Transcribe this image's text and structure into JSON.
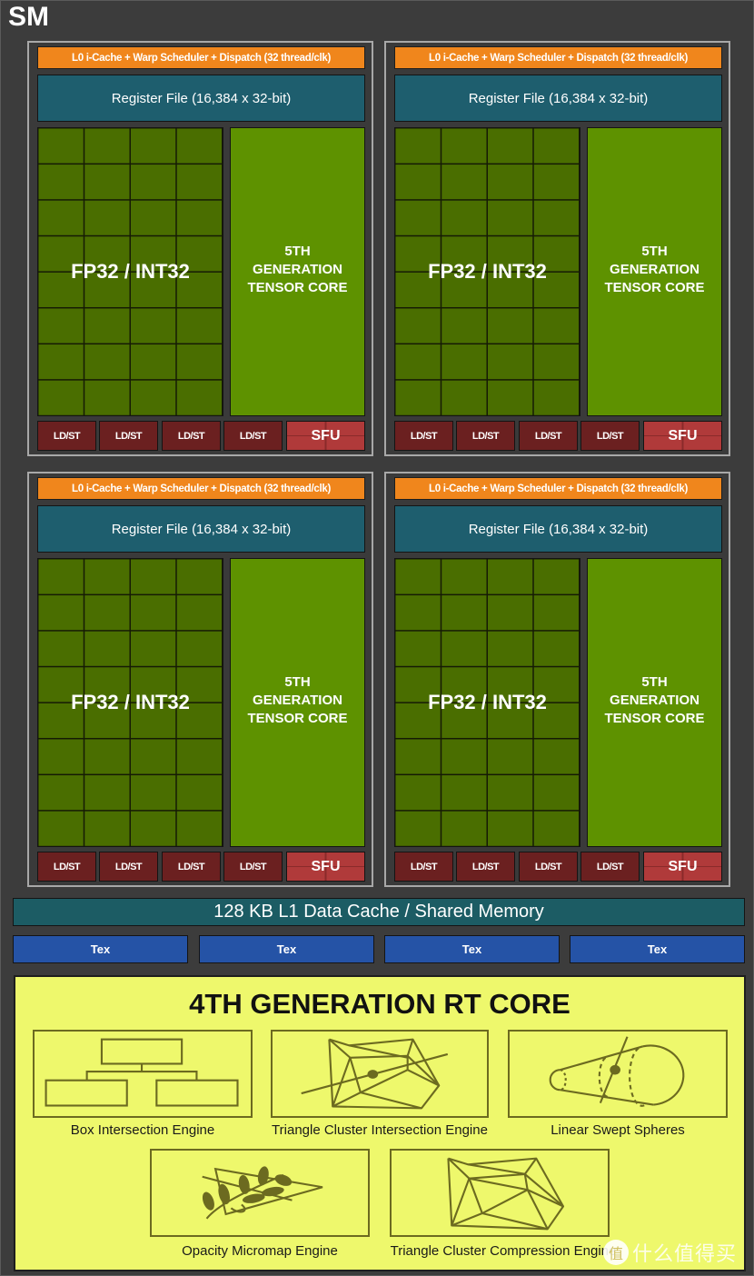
{
  "title": "SM",
  "colors": {
    "background": "#3c3c3c",
    "scheduler": "#f0861c",
    "register_file": "#1e5e6e",
    "fp32_int32": "#4a6e00",
    "tensor_core": "#5e9200",
    "ldst": "#6b2020",
    "sfu": "#b03a3a",
    "l1_cache": "#1c5c64",
    "tex": "#2553a6",
    "rt_core": "#eef86c",
    "rt_icon_stroke": "#6c6a20"
  },
  "partitions": [
    {
      "scheduler": "L0 i-Cache + Warp Scheduler + Dispatch (32 thread/clk)",
      "register_file": "Register File (16,384 x 32-bit)",
      "cores_label": "FP32 / INT32",
      "cores_grid": {
        "columns": 4,
        "rows": 8
      },
      "tensor_core": [
        "5TH",
        "GENERATION",
        "TENSOR CORE"
      ],
      "units": [
        "LD/ST",
        "LD/ST",
        "LD/ST",
        "LD/ST"
      ],
      "sfu": "SFU"
    },
    {
      "scheduler": "L0 i-Cache + Warp Scheduler + Dispatch (32 thread/clk)",
      "register_file": "Register File (16,384 x 32-bit)",
      "cores_label": "FP32 / INT32",
      "cores_grid": {
        "columns": 4,
        "rows": 8
      },
      "tensor_core": [
        "5TH",
        "GENERATION",
        "TENSOR CORE"
      ],
      "units": [
        "LD/ST",
        "LD/ST",
        "LD/ST",
        "LD/ST"
      ],
      "sfu": "SFU"
    },
    {
      "scheduler": "L0 i-Cache + Warp Scheduler + Dispatch (32 thread/clk)",
      "register_file": "Register File (16,384 x 32-bit)",
      "cores_label": "FP32 / INT32",
      "cores_grid": {
        "columns": 4,
        "rows": 8
      },
      "tensor_core": [
        "5TH",
        "GENERATION",
        "TENSOR CORE"
      ],
      "units": [
        "LD/ST",
        "LD/ST",
        "LD/ST",
        "LD/ST"
      ],
      "sfu": "SFU"
    },
    {
      "scheduler": "L0 i-Cache + Warp Scheduler + Dispatch (32 thread/clk)",
      "register_file": "Register File (16,384 x 32-bit)",
      "cores_label": "FP32 / INT32",
      "cores_grid": {
        "columns": 4,
        "rows": 8
      },
      "tensor_core": [
        "5TH",
        "GENERATION",
        "TENSOR CORE"
      ],
      "units": [
        "LD/ST",
        "LD/ST",
        "LD/ST",
        "LD/ST"
      ],
      "sfu": "SFU"
    }
  ],
  "l1_cache": "128 KB L1 Data Cache / Shared Memory",
  "tex_units": [
    "Tex",
    "Tex",
    "Tex",
    "Tex"
  ],
  "rt_core": {
    "title": "4TH GENERATION RT CORE",
    "engines": [
      {
        "label": "Box Intersection Engine",
        "icon": "box-hierarchy-icon"
      },
      {
        "label": "Triangle Cluster Intersection Engine",
        "icon": "triangle-mesh-ray-icon"
      },
      {
        "label": "Linear Swept Spheres",
        "icon": "swept-sphere-icon"
      },
      {
        "label": "Opacity Micromap Engine",
        "icon": "leaf-triangle-icon"
      },
      {
        "label": "Triangle Cluster Compression Engine",
        "icon": "triangle-mesh-icon"
      }
    ]
  },
  "watermark": {
    "logo": "值",
    "text": "什么值得买"
  }
}
